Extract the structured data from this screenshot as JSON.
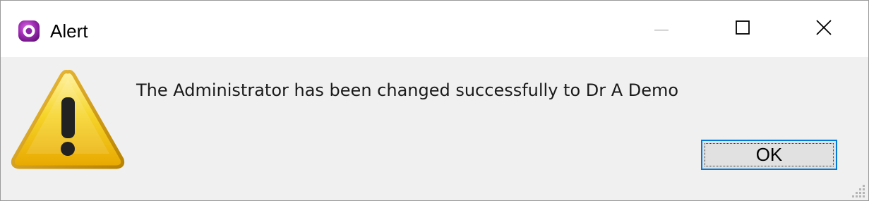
{
  "window": {
    "title": "Alert",
    "controls": {
      "minimize": "minimize-icon",
      "maximize": "maximize-icon",
      "close": "close-icon"
    }
  },
  "dialog": {
    "icon": "warning-icon",
    "message": "The Administrator has been changed successfully to Dr A Demo",
    "ok_label": "OK"
  },
  "colors": {
    "focus_border": "#0078d7",
    "app_icon": "#8e24aa",
    "warning_yellow": "#f5c400"
  }
}
